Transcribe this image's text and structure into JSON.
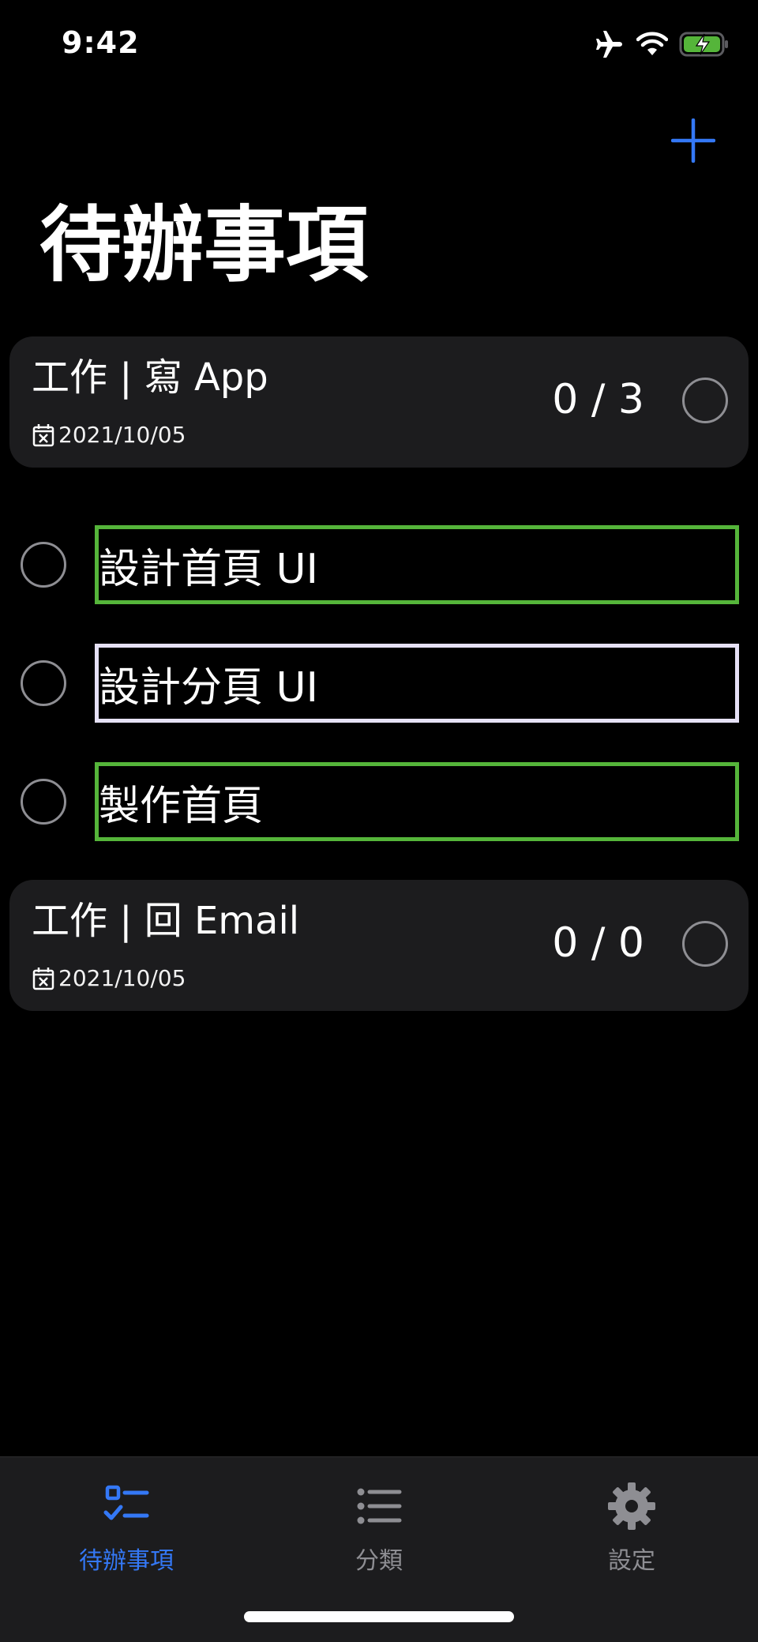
{
  "status_bar": {
    "time": "9:42"
  },
  "header": {
    "title": "待辦事項"
  },
  "colors": {
    "accent": "#3478f6",
    "card": "#1c1c1e",
    "green": "#55b53a",
    "lavender": "#e6e1f7",
    "inactive": "#8e8e93"
  },
  "groups": [
    {
      "title": "工作 | 寫 App",
      "date": "2021/10/05",
      "count": "0 / 3",
      "tasks": [
        {
          "label": "設計首頁 UI",
          "border_color": "#55b53a"
        },
        {
          "label": "設計分頁 UI",
          "border_color": "#e6e1f7"
        },
        {
          "label": "製作首頁",
          "border_color": "#55b53a"
        }
      ]
    },
    {
      "title": "工作 | 回 Email",
      "date": "2021/10/05",
      "count": "0 / 0",
      "tasks": []
    }
  ],
  "tab_bar": {
    "items": [
      {
        "label": "待辦事項",
        "icon": "checklist-icon",
        "active": true
      },
      {
        "label": "分類",
        "icon": "list-icon",
        "active": false
      },
      {
        "label": "設定",
        "icon": "gear-icon",
        "active": false
      }
    ]
  }
}
